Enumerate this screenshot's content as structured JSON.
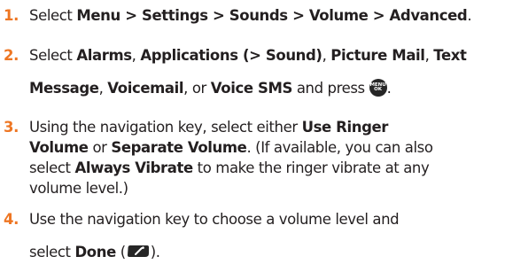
{
  "steps": [
    {
      "number": "1.",
      "lines": [
        [
          {
            "t": "Select ",
            "b": false
          },
          {
            "t": "Menu > Settings > Sounds > Volume > Advanced",
            "b": true
          },
          {
            "t": ".",
            "b": false
          }
        ]
      ]
    },
    {
      "number": "2.",
      "lines": [
        [
          {
            "t": "Select ",
            "b": false
          },
          {
            "t": "Alarms",
            "b": true
          },
          {
            "t": ", ",
            "b": false
          },
          {
            "t": "Applications (> Sound)",
            "b": true
          },
          {
            "t": ", ",
            "b": false
          },
          {
            "t": "Picture Mail",
            "b": true
          },
          {
            "t": ", ",
            "b": false
          },
          {
            "t": "Text",
            "b": true
          }
        ],
        [
          {
            "t": "Message",
            "b": true
          },
          {
            "t": ", ",
            "b": false
          },
          {
            "t": "Voicemail",
            "b": true
          },
          {
            "t": ", or ",
            "b": false
          },
          {
            "t": "Voice SMS",
            "b": true
          },
          {
            "t": " and press ",
            "b": false
          },
          {
            "icon": "menu-ok-key",
            "label": "MENU\nOK"
          },
          {
            "t": ".",
            "b": false
          }
        ]
      ]
    },
    {
      "number": "3.",
      "lines": [
        [
          {
            "t": "Using the navigation key, select either ",
            "b": false
          },
          {
            "t": "Use Ringer",
            "b": true
          }
        ],
        [
          {
            "t": "Volume",
            "b": true
          },
          {
            "t": " or ",
            "b": false
          },
          {
            "t": "Separate Volume",
            "b": true
          },
          {
            "t": ". (If available, you can also",
            "b": false
          }
        ],
        [
          {
            "t": "select ",
            "b": false
          },
          {
            "t": "Always Vibrate",
            "b": true
          },
          {
            "t": " to make the ringer vibrate at any",
            "b": false
          }
        ],
        [
          {
            "t": "volume level.)",
            "b": false
          }
        ]
      ]
    },
    {
      "number": "4.",
      "lines": [
        [
          {
            "t": "Use the navigation key to choose a volume level and",
            "b": false
          }
        ],
        [
          {
            "t": "select ",
            "b": false
          },
          {
            "t": "Done",
            "b": true
          },
          {
            "t": " (",
            "b": false
          },
          {
            "icon": "left-softkey"
          },
          {
            "t": ").",
            "b": false
          }
        ]
      ]
    }
  ],
  "colors": {
    "step_number": "#ee7623",
    "text": "#231f20",
    "key_fill": "#262626"
  }
}
